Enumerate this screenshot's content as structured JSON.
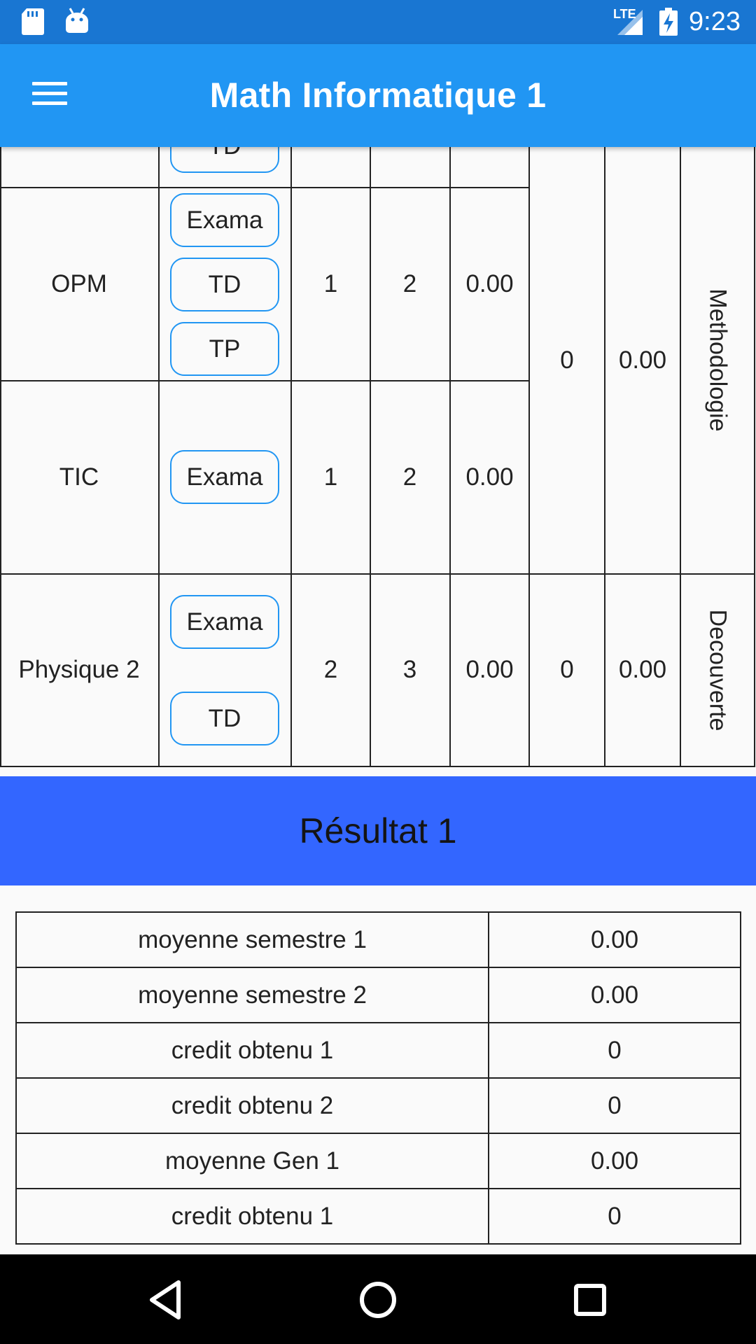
{
  "status_bar": {
    "time": "9:23",
    "network_label": "LTE",
    "icons": [
      "sd-card-icon",
      "android-icon",
      "signal-icon",
      "battery-charging-icon"
    ]
  },
  "app_bar": {
    "title": "Math Informatique 1",
    "menu_icon": "hamburger-menu-icon"
  },
  "modules": [
    {
      "name": "",
      "buttons": [
        "TD"
      ],
      "coef": "",
      "credit": "",
      "average": ""
    },
    {
      "name": "OPM",
      "buttons": [
        "Exama",
        "TD",
        "TP"
      ],
      "coef": "1",
      "credit": "2",
      "average": "0.00"
    },
    {
      "name": "TIC",
      "buttons": [
        "Exama"
      ],
      "coef": "1",
      "credit": "2",
      "average": "0.00"
    },
    {
      "name": "Physique 2",
      "buttons": [
        "Exama",
        "TD"
      ],
      "coef": "2",
      "credit": "3",
      "average": "0.00"
    }
  ],
  "units": [
    {
      "label": "Methodologie",
      "credit": "0",
      "average": "0.00"
    },
    {
      "label": "Decouverte",
      "credit": "0",
      "average": "0.00"
    }
  ],
  "result": {
    "title": "Résultat 1",
    "rows": [
      {
        "label": "moyenne semestre 1",
        "value": "0.00"
      },
      {
        "label": "moyenne semestre 2",
        "value": "0.00"
      },
      {
        "label": "credit obtenu 1",
        "value": "0"
      },
      {
        "label": "credit obtenu 2",
        "value": "0"
      },
      {
        "label": "moyenne Gen 1",
        "value": "0.00"
      },
      {
        "label": "credit obtenu 1",
        "value": "0"
      }
    ]
  },
  "nav_bar": {
    "buttons": [
      "back-icon",
      "home-icon",
      "recents-icon"
    ]
  },
  "colors": {
    "status_bar": "#1976D2",
    "app_bar": "#2196F3",
    "result_banner": "#3366FF",
    "pill_border": "#2196F3",
    "background": "#FAFAFA"
  }
}
